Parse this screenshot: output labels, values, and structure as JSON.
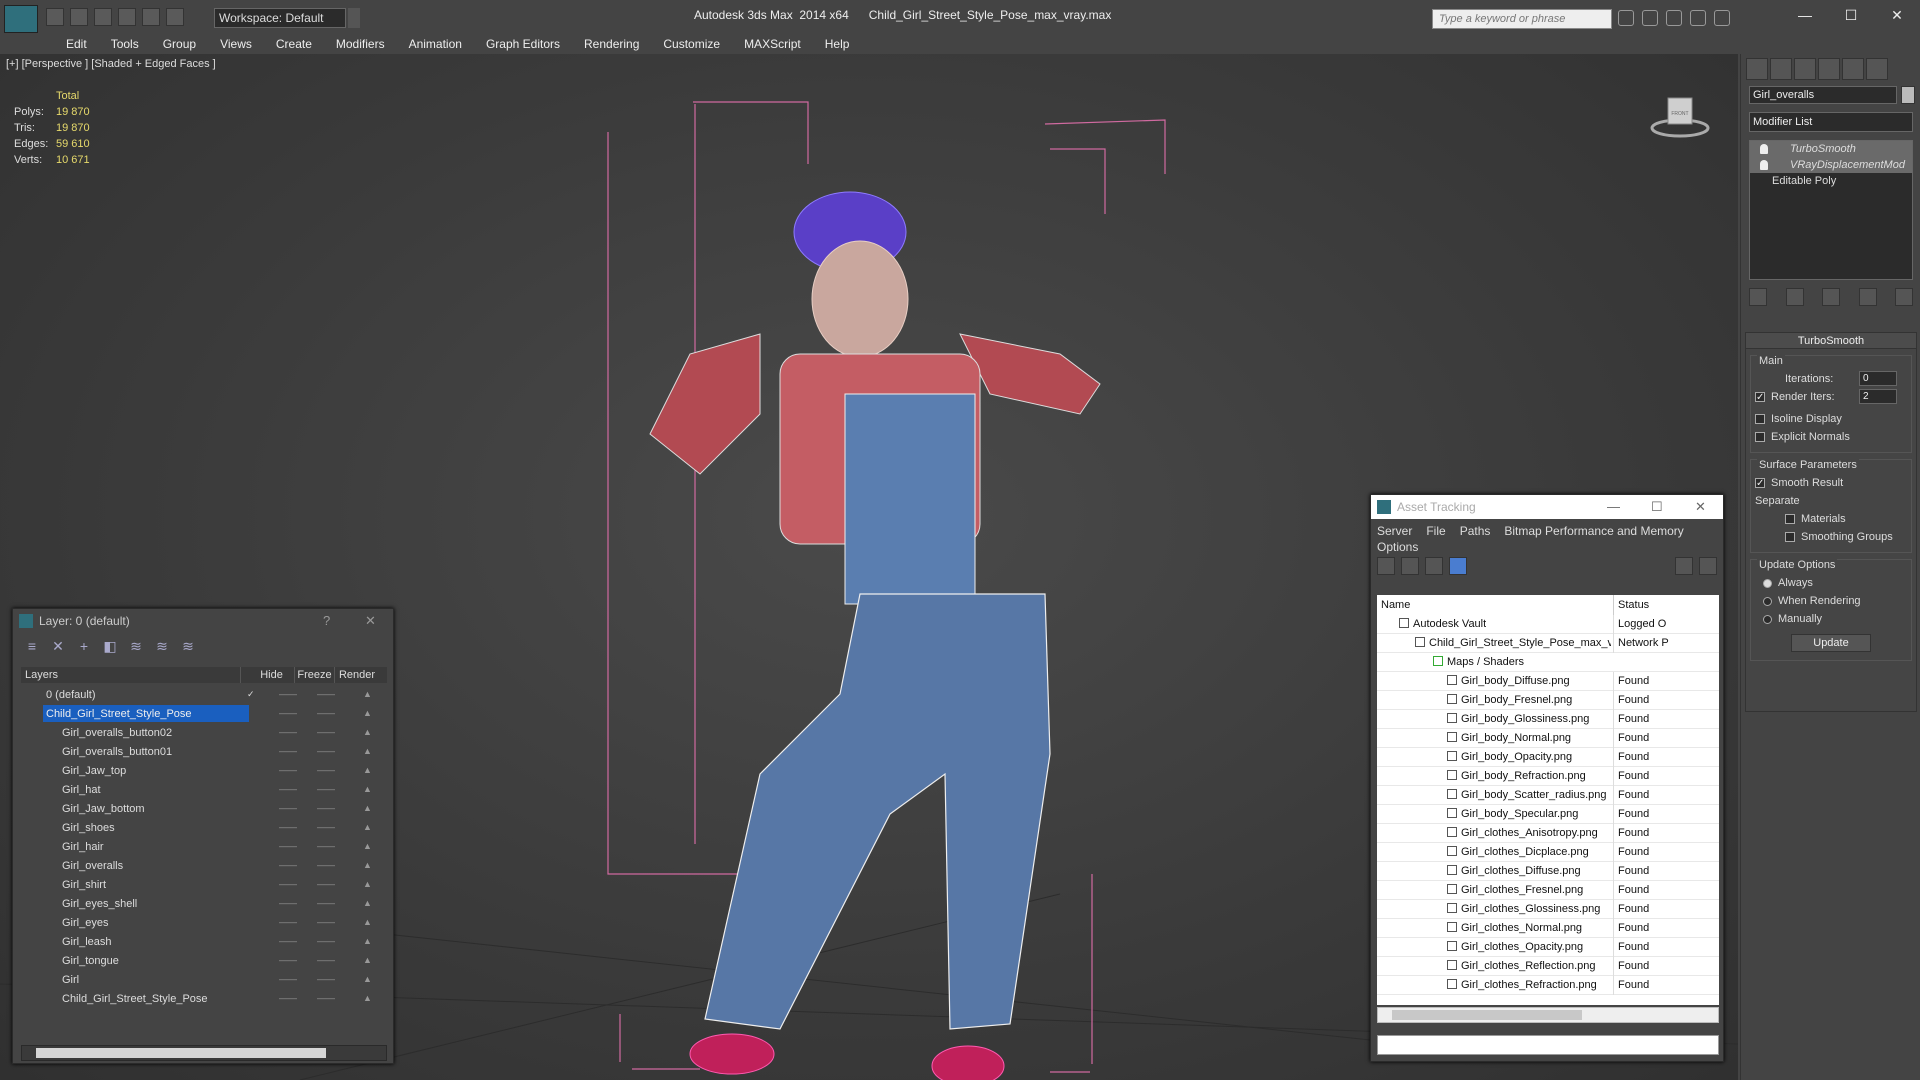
{
  "titlebar": {
    "workspace": "Workspace: Default",
    "app_title": "Autodesk 3ds Max  2014 x64      Child_Girl_Street_Style_Pose_max_vray.max",
    "search_placeholder": "Type a keyword or phrase"
  },
  "menu": [
    "Edit",
    "Tools",
    "Group",
    "Views",
    "Create",
    "Modifiers",
    "Animation",
    "Graph Editors",
    "Rendering",
    "Customize",
    "MAXScript",
    "Help"
  ],
  "viewport": {
    "label": "[+] [Perspective ] [Shaded + Edged Faces ]",
    "stats": {
      "total": "Total",
      "polys_label": "Polys:",
      "polys": "19 870",
      "tris_label": "Tris:",
      "tris": "19 870",
      "edges_label": "Edges:",
      "edges": "59 610",
      "verts_label": "Verts:",
      "verts": "10 671"
    },
    "viewcube": "FRONT"
  },
  "command_panel": {
    "object_name": "Girl_overalls",
    "modifier_list": "Modifier List",
    "stack": [
      "TurboSmooth",
      "VRayDisplacementMod",
      "Editable Poly"
    ],
    "rollout_title": "TurboSmooth",
    "main_group": "Main",
    "iterations_label": "Iterations:",
    "iterations": "0",
    "render_iters_label": "Render Iters:",
    "render_iters": "2",
    "isoline": "Isoline Display",
    "explicit_normals": "Explicit Normals",
    "surface_group": "Surface Parameters",
    "smooth_result": "Smooth Result",
    "separate": "Separate",
    "materials": "Materials",
    "smoothing_groups": "Smoothing Groups",
    "update_group": "Update Options",
    "always": "Always",
    "when_rendering": "When Rendering",
    "manually": "Manually",
    "update": "Update"
  },
  "layer_window": {
    "title": "Layer: 0 (default)",
    "help": "?",
    "close": "✕",
    "headers": {
      "layers": "Layers",
      "hide": "Hide",
      "freeze": "Freeze",
      "render": "Render"
    },
    "rows": [
      "0 (default)",
      "Child_Girl_Street_Style_Pose",
      "Girl_overalls_button02",
      "Girl_overalls_button01",
      "Girl_Jaw_top",
      "Girl_hat",
      "Girl_Jaw_bottom",
      "Girl_shoes",
      "Girl_hair",
      "Girl_overalls",
      "Girl_shirt",
      "Girl_eyes_shell",
      "Girl_eyes",
      "Girl_leash",
      "Girl_tongue",
      "Girl",
      "Child_Girl_Street_Style_Pose"
    ]
  },
  "asset_window": {
    "title": "Asset Tracking",
    "min": "—",
    "max": "☐",
    "close": "✕",
    "menu": [
      "Server",
      "File",
      "Paths",
      "Bitmap Performance and Memory",
      "Options"
    ],
    "headers": {
      "name": "Name",
      "status": "Status"
    },
    "rows": [
      {
        "name": "Autodesk Vault",
        "status": "Logged O"
      },
      {
        "name": "Child_Girl_Street_Style_Pose_max_vray.max",
        "status": "Network P"
      },
      {
        "name": "Maps / Shaders",
        "status": ""
      },
      {
        "name": "Girl_body_Diffuse.png",
        "status": "Found"
      },
      {
        "name": "Girl_body_Fresnel.png",
        "status": "Found"
      },
      {
        "name": "Girl_body_Glossiness.png",
        "status": "Found"
      },
      {
        "name": "Girl_body_Normal.png",
        "status": "Found"
      },
      {
        "name": "Girl_body_Opacity.png",
        "status": "Found"
      },
      {
        "name": "Girl_body_Refraction.png",
        "status": "Found"
      },
      {
        "name": "Girl_body_Scatter_radius.png",
        "status": "Found"
      },
      {
        "name": "Girl_body_Specular.png",
        "status": "Found"
      },
      {
        "name": "Girl_clothes_Anisotropy.png",
        "status": "Found"
      },
      {
        "name": "Girl_clothes_Dicplace.png",
        "status": "Found"
      },
      {
        "name": "Girl_clothes_Diffuse.png",
        "status": "Found"
      },
      {
        "name": "Girl_clothes_Fresnel.png",
        "status": "Found"
      },
      {
        "name": "Girl_clothes_Glossiness.png",
        "status": "Found"
      },
      {
        "name": "Girl_clothes_Normal.png",
        "status": "Found"
      },
      {
        "name": "Girl_clothes_Opacity.png",
        "status": "Found"
      },
      {
        "name": "Girl_clothes_Reflection.png",
        "status": "Found"
      },
      {
        "name": "Girl_clothes_Refraction.png",
        "status": "Found"
      }
    ]
  }
}
